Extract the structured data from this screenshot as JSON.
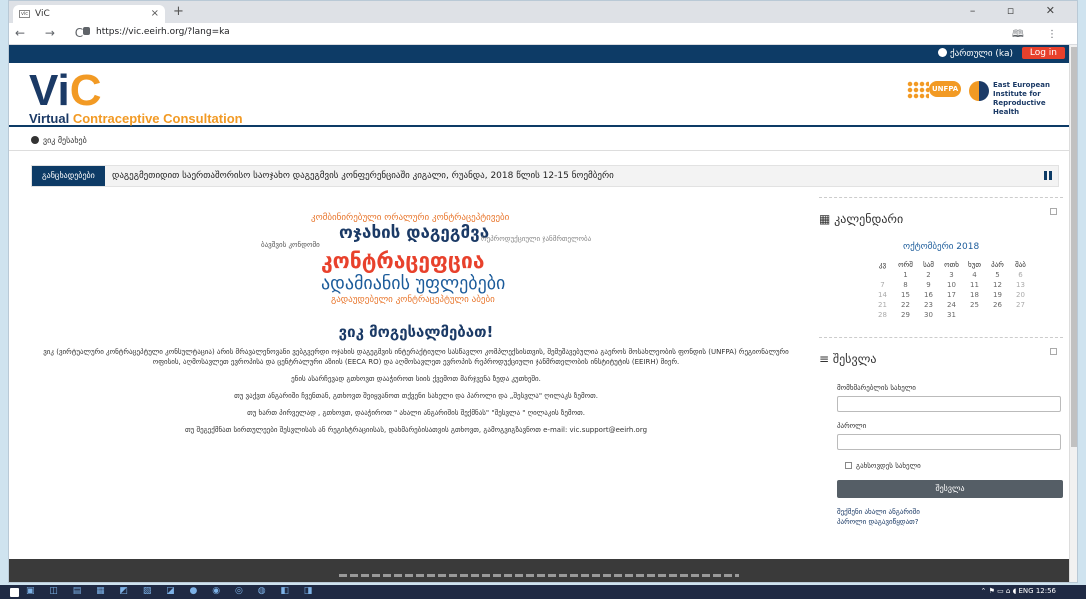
{
  "browser": {
    "tab_title": "ViC",
    "tab_close": "×",
    "new_tab": "+",
    "window_controls": "–  ▫  ✕",
    "nav": "← → C",
    "url": "https://vic.eeirh.org/?lang=ka",
    "addr_icons": "🕮 ⋮"
  },
  "topbar": {
    "language": "ქართული (ka)",
    "login": "Log in"
  },
  "header": {
    "logo_v": "Vi",
    "logo_c": "C",
    "sub_virtual": "Virtual ",
    "sub_rest": "Contraceptive Consultation",
    "partner1": "UNFPA",
    "partner2": "East European Institute for Reproductive Health"
  },
  "breadcrumb": "ვიკ მესახებ",
  "ticker": {
    "label": "განცხადებები",
    "text": "დაგეგმეთიდით საერთაშორისო საოჯახო დაგეგმვის კონფერენციაში კიგალი, რუანდა, 2018 წლის 12-15 ნოემბერი"
  },
  "cloud": [
    {
      "text": "კომბინირებული ორალური კონტრაცეპტივები",
      "color": "#e8752b"
    },
    {
      "text": "ოჯახის დაგეგმვა",
      "color": "#1b3a66"
    },
    {
      "text": "კონტრაცეფცია",
      "color": "#e8412c"
    },
    {
      "text": "ადამიანის უფლებები",
      "color": "#1b5b9a"
    },
    {
      "text": "გადაუდებელი კონტრაცეპტული აბები",
      "color": "#e8752b"
    },
    {
      "text": "ბავშვის კონდომი",
      "color": "#555"
    },
    {
      "text": "რეპროდუქციული ჯანმრთელობა",
      "color": "#888"
    }
  ],
  "main": {
    "welcome": "ვიკ მოგესალმებათ!",
    "p1": "ვიკ (ვირტუალური კონტრაცეპტული კონსულტაცია) არის მრავალენოვანი ვებგვერდი ოჯახის დაგეგმვის ინტერაქტიული სასწავლო კომპლექსისთვის, შემუშავებულია გაეროს მოსახლეობის ფონდის (UNFPA) რეგიონალური ოფისის, აღმოსავლეთ ევროპისა და ცენტრალური აზიის (EECA RO) და აღმოსავლეთ ევროპის რეპროდუქციული ჯანმრთელობის ინსტიტუტის (EEIRH) მიერ.",
    "p2": "ენის ასარჩევად გთხოვთ დააჭიროთ სიის ქვემოთ მარჯვენა ზედა კუთხეში.",
    "p3": "თუ ვაქვთ ანგარიში ჩვენთან, გთხოვთ შეიყვანოთ თქვენი სახელი და პაროლი და „შესვლა\" ღილაკს ზემოთ.",
    "p4": "თუ ხართ პირველად , გთხოვთ, დააჭიროთ \" ახალი ანგარიშის შექმნას\" \"შესვლა \" ღილაკის ზემოთ.",
    "p5": "თუ შეგექმნათ სირთულეები შესვლისას ან რეგისტრაციისას, დახმარებისათვის გთხოვთ, გამოგვიგზავნოთ e-mail: vic.support@eeirh.org"
  },
  "calendar": {
    "title": "კალენდარი",
    "month": "ოქტომბერი 2018",
    "days": [
      "კვ",
      "ორშ",
      "სამ",
      "ოთხ",
      "ხუთ",
      "პარ",
      "შაბ"
    ],
    "rows": [
      [
        "",
        "1",
        "2",
        "3",
        "4",
        "5",
        "6"
      ],
      [
        "7",
        "8",
        "9",
        "10",
        "11",
        "12",
        "13"
      ],
      [
        "14",
        "15",
        "16",
        "17",
        "18",
        "19",
        "20"
      ],
      [
        "21",
        "22",
        "23",
        "24",
        "25",
        "26",
        "27"
      ],
      [
        "28",
        "29",
        "30",
        "31",
        "",
        "",
        ""
      ]
    ]
  },
  "login": {
    "title": "შესვლა",
    "username_label": "მომხმარებლის სახელი",
    "password_label": "პაროლი",
    "remember": "გახსოვდეს სახელი",
    "button": "შესვლა",
    "create": "შექმენი ახალი ანგარიში",
    "forgot": "პაროლი დაგავიწყდათ?"
  },
  "taskbar": {
    "icons": "▣ ◫ ▤ ▦ ◩ ▧ ◪ ● ◉ ◎ ◍ ◧ ◨",
    "tray": "⌃ ⚑ ▭ ⌂ ◖ ENG  12:56"
  }
}
